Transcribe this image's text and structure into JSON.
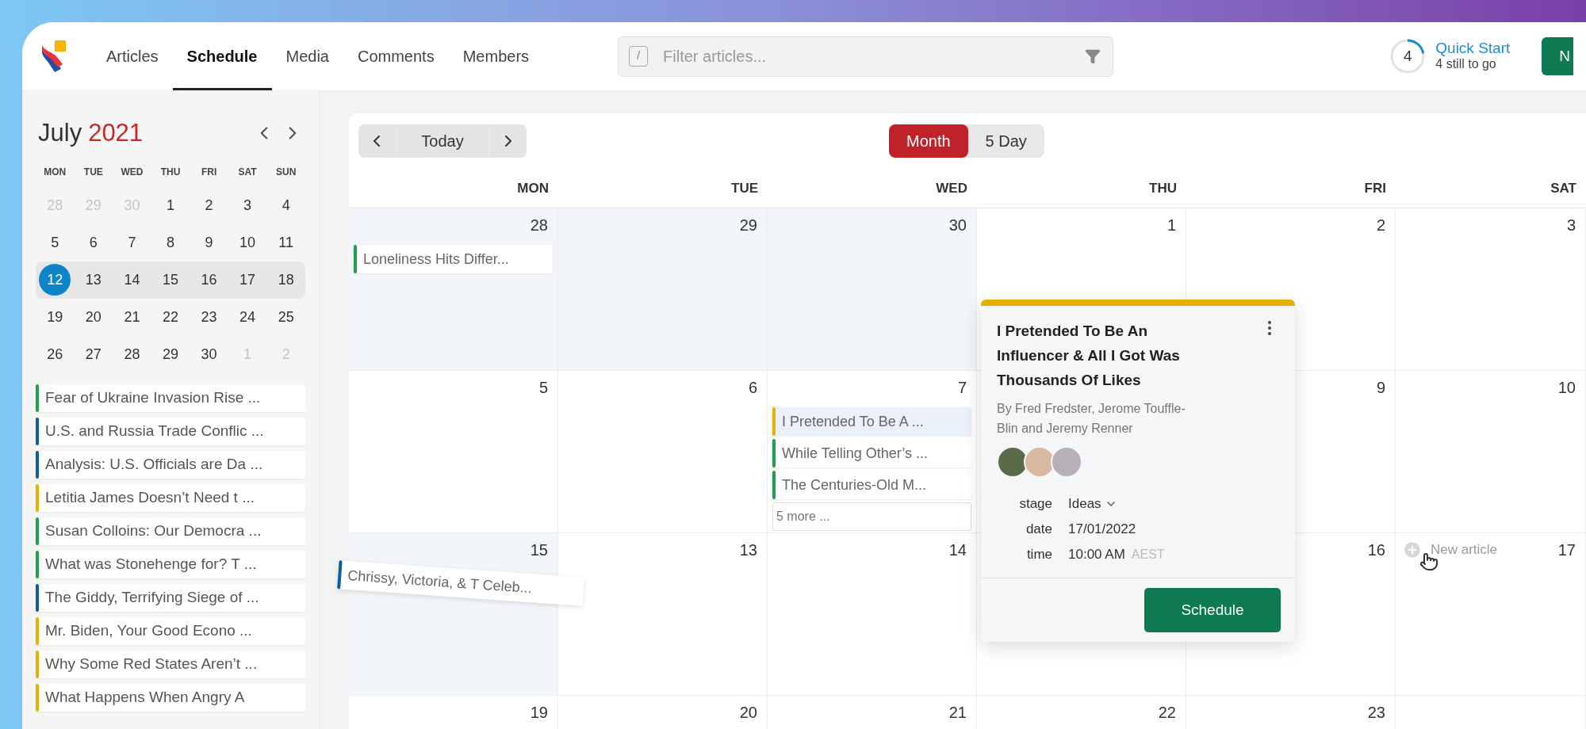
{
  "header": {
    "nav": [
      {
        "label": "Articles",
        "selected": false
      },
      {
        "label": "Schedule",
        "selected": true
      },
      {
        "label": "Media",
        "selected": false
      },
      {
        "label": "Comments",
        "selected": false
      },
      {
        "label": "Members",
        "selected": false
      }
    ],
    "search": {
      "shortcut": "/",
      "placeholder": "Filter articles..."
    },
    "quick_start": {
      "count": "4",
      "level": 0.22,
      "title": "Quick Start",
      "subtitle": "4 still to go"
    },
    "new_button": "N"
  },
  "mini_calendar": {
    "month": "July",
    "year": "2021",
    "weekdays": [
      "MON",
      "TUE",
      "WED",
      "THU",
      "FRI",
      "SAT",
      "SUN"
    ],
    "weeks": [
      {
        "highlighted": false,
        "days": [
          {
            "label": "28",
            "muted": true,
            "selected": false
          },
          {
            "label": "29",
            "muted": true,
            "selected": false
          },
          {
            "label": "30",
            "muted": true,
            "selected": false
          },
          {
            "label": "1",
            "muted": false,
            "selected": false
          },
          {
            "label": "2",
            "muted": false,
            "selected": false
          },
          {
            "label": "3",
            "muted": false,
            "selected": false
          },
          {
            "label": "4",
            "muted": false,
            "selected": false
          }
        ]
      },
      {
        "highlighted": false,
        "days": [
          {
            "label": "5",
            "muted": false,
            "selected": false
          },
          {
            "label": "6",
            "muted": false,
            "selected": false
          },
          {
            "label": "7",
            "muted": false,
            "selected": false
          },
          {
            "label": "8",
            "muted": false,
            "selected": false
          },
          {
            "label": "9",
            "muted": false,
            "selected": false
          },
          {
            "label": "10",
            "muted": false,
            "selected": false
          },
          {
            "label": "11",
            "muted": false,
            "selected": false
          }
        ]
      },
      {
        "highlighted": true,
        "days": [
          {
            "label": "12",
            "muted": false,
            "selected": true
          },
          {
            "label": "13",
            "muted": false,
            "selected": false
          },
          {
            "label": "14",
            "muted": false,
            "selected": false
          },
          {
            "label": "15",
            "muted": false,
            "selected": false
          },
          {
            "label": "16",
            "muted": false,
            "selected": false
          },
          {
            "label": "17",
            "muted": false,
            "selected": false
          },
          {
            "label": "18",
            "muted": false,
            "selected": false
          }
        ]
      },
      {
        "highlighted": false,
        "days": [
          {
            "label": "19",
            "muted": false,
            "selected": false
          },
          {
            "label": "20",
            "muted": false,
            "selected": false
          },
          {
            "label": "21",
            "muted": false,
            "selected": false
          },
          {
            "label": "22",
            "muted": false,
            "selected": false
          },
          {
            "label": "23",
            "muted": false,
            "selected": false
          },
          {
            "label": "24",
            "muted": false,
            "selected": false
          },
          {
            "label": "25",
            "muted": false,
            "selected": false
          }
        ]
      },
      {
        "highlighted": false,
        "days": [
          {
            "label": "26",
            "muted": false,
            "selected": false
          },
          {
            "label": "27",
            "muted": false,
            "selected": false
          },
          {
            "label": "28",
            "muted": false,
            "selected": false
          },
          {
            "label": "29",
            "muted": false,
            "selected": false
          },
          {
            "label": "30",
            "muted": false,
            "selected": false
          },
          {
            "label": "1",
            "muted": true,
            "selected": false
          },
          {
            "label": "2",
            "muted": true,
            "selected": false
          }
        ]
      }
    ]
  },
  "sidebar_articles": [
    {
      "title": "Fear of Ukraine Invasion Rise ...",
      "color": "#1aa34a"
    },
    {
      "title": "U.S. and Russia Trade Conflic ...",
      "color": "#0b5f9e"
    },
    {
      "title": "Analysis: U.S. Officials are Da ...",
      "color": "#0b5f9e"
    },
    {
      "title": "Letitia James Doesn’t Need t ...",
      "color": "#e6b000"
    },
    {
      "title": "Susan Colloins: Our Democra ...",
      "color": "#1aa34a"
    },
    {
      "title": "What was Stonehenge for? T ...",
      "color": "#1aa34a"
    },
    {
      "title": "The Giddy, Terrifying Siege of ...",
      "color": "#0b5f9e"
    },
    {
      "title": "Mr. Biden, Your Good Econo ...",
      "color": "#e6b000"
    },
    {
      "title": "Why Some Red States Aren’t ...",
      "color": "#e6b000"
    },
    {
      "title": "What Happens When Angry A",
      "color": "#e6b000"
    }
  ],
  "calendar": {
    "today": "Today",
    "views": [
      {
        "label": "Month",
        "selected": true
      },
      {
        "label": "5 Day",
        "selected": false
      }
    ],
    "weekdays": [
      "MON",
      "TUE",
      "WED",
      "THU",
      "FRI",
      "SAT"
    ],
    "weeks": [
      {
        "days": [
          {
            "date": "28",
            "shaded": true,
            "events": [
              {
                "title": "Loneliness Hits Differ...",
                "color": "#1aa34a",
                "selected": false
              }
            ]
          },
          {
            "date": "29",
            "shaded": true
          },
          {
            "date": "30",
            "shaded": true
          },
          {
            "date": "1",
            "shaded": false
          },
          {
            "date": "2",
            "shaded": false
          },
          {
            "date": "3",
            "shaded": false
          }
        ]
      },
      {
        "days": [
          {
            "date": "5",
            "shaded": false
          },
          {
            "date": "6",
            "shaded": false
          },
          {
            "date": "7",
            "shaded": false,
            "events": [
              {
                "title": "I Pretended To Be A ...",
                "color": "#e6b000",
                "selected": true
              },
              {
                "title": "While Telling Other’s ...",
                "color": "#1aa34a",
                "selected": false
              },
              {
                "title": "The Centuries-Old M...",
                "color": "#1aa34a",
                "selected": false
              }
            ],
            "more": "5 more ..."
          },
          {
            "shaded": false
          },
          {
            "date": "9",
            "shaded": false
          },
          {
            "date": "10",
            "shaded": false
          }
        ]
      },
      {
        "days": [
          {
            "date": "15",
            "shaded": true
          },
          {
            "date": "13",
            "shaded": false
          },
          {
            "date": "14",
            "shaded": false
          },
          {
            "shaded": false
          },
          {
            "date": "16",
            "shaded": false
          },
          {
            "date": "17",
            "shaded": false,
            "new_article": "New article"
          }
        ]
      },
      {
        "days": [
          {
            "date": "19",
            "shaded": false
          },
          {
            "date": "20",
            "shaded": false
          },
          {
            "date": "21",
            "shaded": false
          },
          {
            "date": "22",
            "shaded": false
          },
          {
            "date": "23",
            "shaded": false
          },
          {
            "shaded": false
          }
        ]
      }
    ],
    "dragged_event": {
      "title": "Chrissy, Victoria, & T Celeb...",
      "color": "#0b5f9e"
    },
    "popup": {
      "color": "#e6b000",
      "title": "I Pretended To Be An Influencer & All I Got Was Thousands Of Likes",
      "byline": "By Fred Fredster, Jerome Touffle-Blin and Jeremy Renner",
      "fields": [
        {
          "kind": "select",
          "label": "stage",
          "value": "Ideas"
        },
        {
          "kind": "text",
          "label": "date",
          "value": "17/01/2022"
        },
        {
          "kind": "text",
          "label": "time",
          "value": "10:00 AM",
          "note": "AEST"
        }
      ],
      "button": "Schedule"
    }
  }
}
